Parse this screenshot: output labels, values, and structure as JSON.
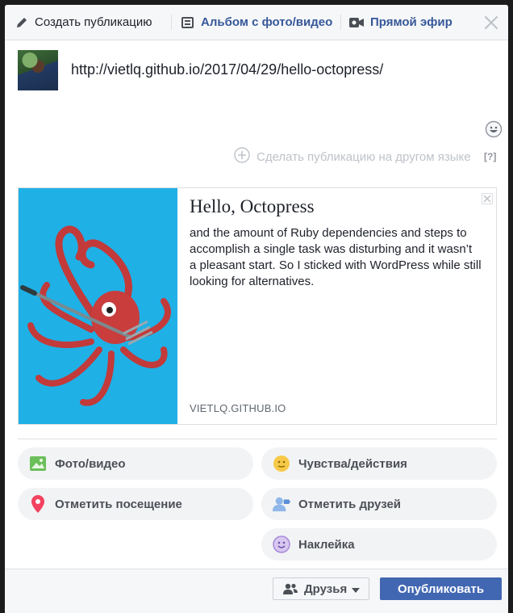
{
  "tabs": {
    "create_post": "Создать публикацию",
    "album": "Альбом с фото/видео",
    "live": "Прямой эфир"
  },
  "composer": {
    "text": "http://vietlq.github.io/2017/04/29/hello-octopress/",
    "other_language": "Сделать публикацию на другом языке",
    "help": "[?]"
  },
  "link_card": {
    "title": "Hello, Octopress",
    "description": "and the amount of Ruby dependencies and steps to accomplish a single task was disturbing and it wasn’t a pleasant start. So I sticked with WordPress while still looking for alternatives.",
    "domain": "VIETLQ.GITHUB.IO"
  },
  "actions": [
    {
      "label": "Фото/видео",
      "icon": "photo-icon"
    },
    {
      "label": "Чувства/действия",
      "icon": "feeling-icon"
    },
    {
      "label": "Отметить посещение",
      "icon": "location-pin-icon"
    },
    {
      "label": "Отметить друзей",
      "icon": "tag-friends-icon"
    },
    {
      "label": "Наклейка",
      "icon": "sticker-icon"
    }
  ],
  "footer": {
    "audience": "Друзья",
    "publish": "Опубликовать"
  },
  "colors": {
    "brand_blue": "#4267b2",
    "link_blue": "#365899",
    "card_image_bg": "#1fb0e6"
  }
}
